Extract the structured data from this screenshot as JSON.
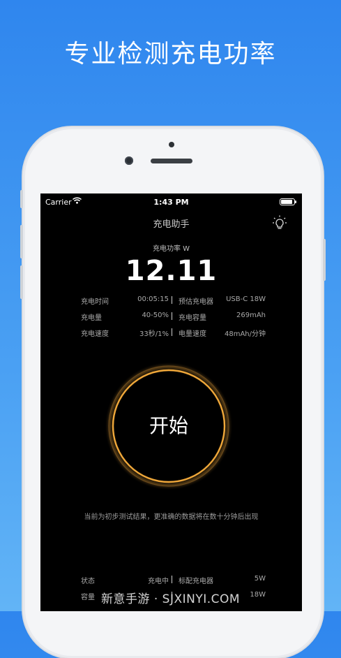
{
  "headline": "专业检测充电功率",
  "status_bar": {
    "carrier": "Carrier",
    "time": "1:43 PM",
    "battery_level": 0.9
  },
  "nav": {
    "title": "充电助手"
  },
  "power": {
    "label": "充电功率 W",
    "value": "12.11"
  },
  "stats": [
    {
      "left_label": "充电时间",
      "left_value": "00:05:15",
      "right_label": "预估充电器",
      "right_value": "USB-C 18W"
    },
    {
      "left_label": "充电量",
      "left_value": "40-50%",
      "right_label": "充电容量",
      "right_value": "269mAh"
    },
    {
      "left_label": "充电速度",
      "left_value": "33秒/1%",
      "right_label": "电量速度",
      "right_value": "48mAh/分钟"
    }
  ],
  "start_button": {
    "label": "开始"
  },
  "hint": "当前为初步测试结果，更准确的数据将在数十分钟后出现",
  "bottom_stats": [
    {
      "left_label": "状态",
      "left_value": "充电中",
      "right_label": "标配充电器",
      "right_value": "5W"
    },
    {
      "left_label": "容量",
      "left_value": "",
      "right_label": "",
      "right_value": "18W"
    }
  ],
  "watermark": "新意手游 · SJXINYI.COM",
  "colors": {
    "background_top": "#2f86ee",
    "ring": "#e8a33a",
    "screen": "#000000"
  }
}
